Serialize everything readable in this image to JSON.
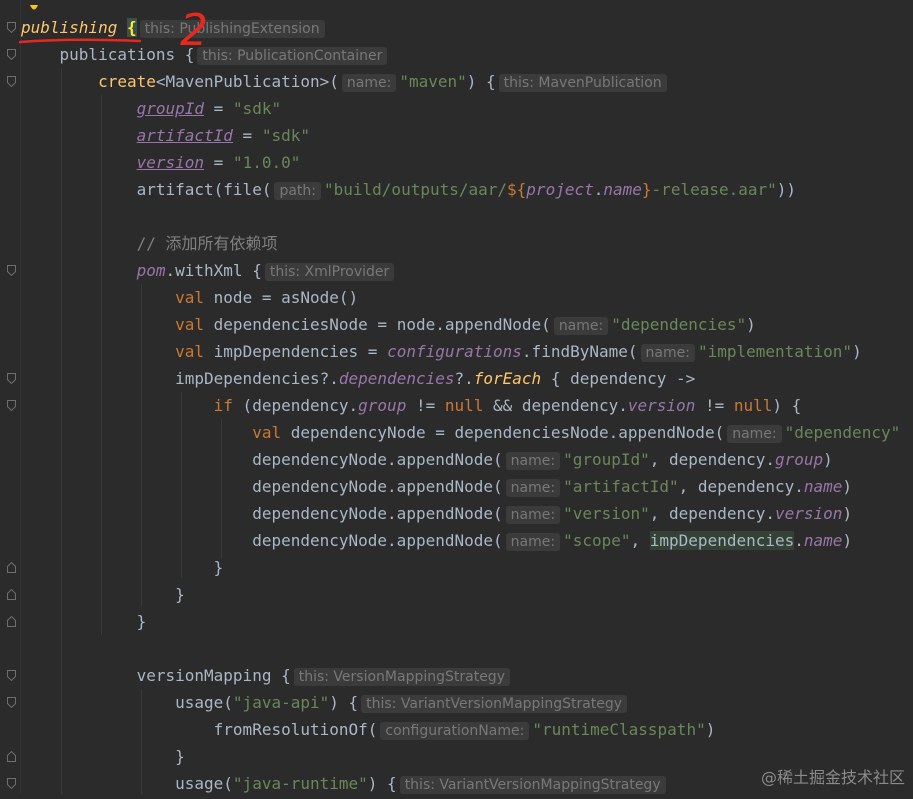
{
  "colors": {
    "background": "#2b2b2b",
    "keyword": "#cc7832",
    "string": "#6a8759",
    "property": "#9876aa",
    "function": "#ffc66d",
    "plain": "#a9b7c6",
    "hint": "#787878",
    "annotation": "#e6281e"
  },
  "icons": {
    "intention": "lightbulb-icon",
    "fold": "fold-marker-icon"
  },
  "annotation": {
    "digit": "2"
  },
  "code": {
    "l1": {
      "kw": "publishing",
      "brace": "{",
      "hint": "this: PublishingExtension"
    },
    "l2": {
      "text": "publications {",
      "hint": "this: PublicationContainer"
    },
    "l3": {
      "fn": "create",
      "type": "<MavenPublication>(",
      "hint": "name:",
      "str": "\"maven\"",
      "close": ") {",
      "hint2": "this: MavenPublication"
    },
    "l4": {
      "prop": "groupId",
      "eq": " = ",
      "str": "\"sdk\""
    },
    "l5": {
      "prop": "artifactId",
      "eq": " = ",
      "str": "\"sdk\""
    },
    "l6": {
      "prop": "version",
      "eq": " = ",
      "str": "\"1.0.0\""
    },
    "l7": {
      "pre": "artifact(file(",
      "hint": "path:",
      "s1": "\"build/outputs/aar/",
      "tpl_open": "${",
      "p1": "project",
      "dot": ".",
      "p2": "name",
      "tpl_close": "}",
      "s2": "-release.aar\"",
      "close": "))"
    },
    "l8": {},
    "l9": {
      "comment": "// 添加所有依赖项"
    },
    "l10": {
      "p": "pom",
      "rest": ".withXml {",
      "hint": "this: XmlProvider"
    },
    "l11": {
      "kw": "val",
      "rest": " node = asNode()"
    },
    "l12": {
      "kw": "val",
      "rest": " dependenciesNode = node.appendNode(",
      "hint": "name:",
      "str": "\"dependencies\"",
      "close": ")"
    },
    "l13": {
      "kw": "val",
      "rest": " impDependencies = ",
      "p": "configurations",
      "rest2": ".findByName(",
      "hint": "name:",
      "str": "\"implementation\"",
      "close": ")"
    },
    "l14": {
      "pre": "impDependencies?.",
      "p": "dependencies",
      "mid": "?.",
      "ext": "forEach",
      "rest": " { dependency ->"
    },
    "l15": {
      "kw": "if",
      "a": " (dependency.",
      "p1": "group",
      "b": " != ",
      "n1": "null",
      "c": " && dependency.",
      "p2": "version",
      "d": " != ",
      "n2": "null",
      "e": ") {"
    },
    "l16": {
      "kw": "val",
      "rest": " dependencyNode = dependenciesNode.appendNode(",
      "hint": "name:",
      "str": "\"dependency\""
    },
    "l17": {
      "pre": "dependencyNode.appendNode(",
      "hint": "name:",
      "str": "\"groupId\"",
      "mid": ", dependency.",
      "p": "group",
      "close": ")"
    },
    "l18": {
      "pre": "dependencyNode.appendNode(",
      "hint": "name:",
      "str": "\"artifactId\"",
      "mid": ", dependency.",
      "p": "name",
      "close": ")"
    },
    "l19": {
      "pre": "dependencyNode.appendNode(",
      "hint": "name:",
      "str": "\"version\"",
      "mid": ", dependency.",
      "p": "version",
      "close": ")"
    },
    "l20": {
      "pre": "dependencyNode.appendNode(",
      "hint": "name:",
      "str": "\"scope\"",
      "mid": ", ",
      "v": "impDependencies",
      "dot": ".",
      "p": "name",
      "close": ")"
    },
    "l21": {
      "text": "}"
    },
    "l22": {
      "text": "}"
    },
    "l23": {
      "text": "}"
    },
    "l24": {},
    "l25": {
      "text": "versionMapping {",
      "hint": "this: VersionMappingStrategy"
    },
    "l26": {
      "pre": "usage(",
      "str": "\"java-api\"",
      "close": ") {",
      "hint": "this: VariantVersionMappingStrategy"
    },
    "l27": {
      "pre": "fromResolutionOf(",
      "hint": "configurationName:",
      "str": "\"runtimeClasspath\"",
      "close": ")"
    },
    "l28": {
      "text": "}"
    },
    "l29": {
      "pre": "usage(",
      "str": "\"java-runtime\"",
      "close": ") {",
      "hint": "this: VariantVersionMappingStrategy"
    }
  },
  "watermark": "@稀土掘金技术社区"
}
